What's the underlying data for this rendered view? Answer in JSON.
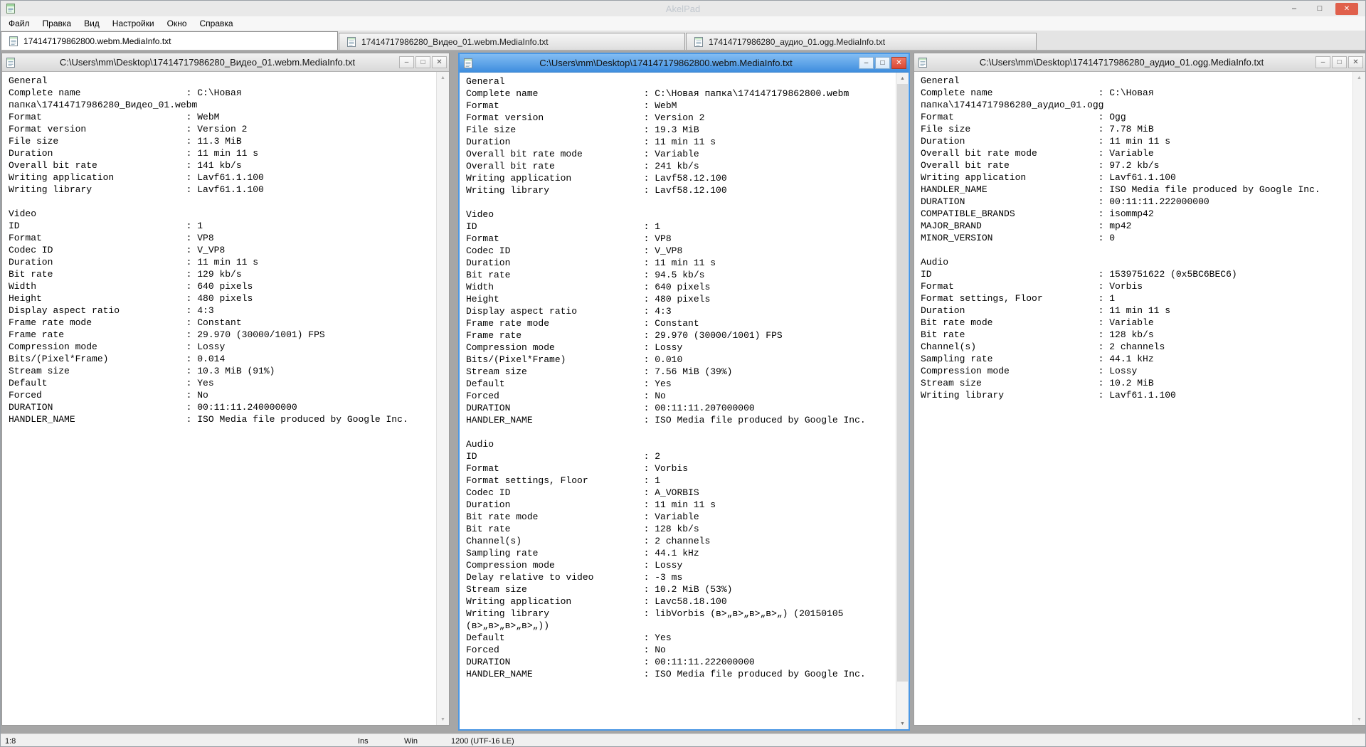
{
  "app": {
    "title": "AkelPad"
  },
  "glyphs": {
    "minimize": "–",
    "maximize": "□",
    "close": "✕",
    "scroll_up": "▲",
    "scroll_down": "▼"
  },
  "colors": {
    "active_titlebar": "#4a97e4",
    "main_close_button": "#e0604c",
    "child_close_button": "#db4734"
  },
  "menu": {
    "items": [
      "Файл",
      "Правка",
      "Вид",
      "Настройки",
      "Окно",
      "Справка"
    ]
  },
  "tabs": [
    {
      "label": "174147179862800.webm.MediaInfo.txt",
      "active": true,
      "icon": "document-icon"
    },
    {
      "label": "17414717986280_Видео_01.webm.MediaInfo.txt",
      "active": false,
      "icon": "document-icon"
    },
    {
      "label": "17414717986280_аудио_01.ogg.MediaInfo.txt",
      "active": false,
      "icon": "document-icon"
    }
  ],
  "windows": [
    {
      "title": "C:\\Users\\mm\\Desktop\\17414717986280_Видео_01.webm.MediaInfo.txt",
      "active": false,
      "lines": [
        [
          "General"
        ],
        [
          "Complete name",
          "C:\\Новая"
        ],
        [
          "папка\\17414717986280_Видео_01.webm"
        ],
        [
          "Format",
          "WebM"
        ],
        [
          "Format version",
          "Version 2"
        ],
        [
          "File size",
          "11.3 MiB"
        ],
        [
          "Duration",
          "11 min 11 s"
        ],
        [
          "Overall bit rate",
          "141 kb/s"
        ],
        [
          "Writing application",
          "Lavf61.1.100"
        ],
        [
          "Writing library",
          "Lavf61.1.100"
        ],
        [],
        [
          "Video"
        ],
        [
          "ID",
          "1"
        ],
        [
          "Format",
          "VP8"
        ],
        [
          "Codec ID",
          "V_VP8"
        ],
        [
          "Duration",
          "11 min 11 s"
        ],
        [
          "Bit rate",
          "129 kb/s"
        ],
        [
          "Width",
          "640 pixels"
        ],
        [
          "Height",
          "480 pixels"
        ],
        [
          "Display aspect ratio",
          "4:3"
        ],
        [
          "Frame rate mode",
          "Constant"
        ],
        [
          "Frame rate",
          "29.970 (30000/1001) FPS"
        ],
        [
          "Compression mode",
          "Lossy"
        ],
        [
          "Bits/(Pixel*Frame)",
          "0.014"
        ],
        [
          "Stream size",
          "10.3 MiB (91%)"
        ],
        [
          "Default",
          "Yes"
        ],
        [
          "Forced",
          "No"
        ],
        [
          "DURATION",
          "00:11:11.240000000"
        ],
        [
          "HANDLER_NAME",
          "ISO Media file produced by Google Inc."
        ]
      ]
    },
    {
      "title": "C:\\Users\\mm\\Desktop\\174147179862800.webm.MediaInfo.txt",
      "active": true,
      "lines": [
        [
          "General"
        ],
        [
          "Complete name",
          "C:\\Новая папка\\174147179862800.webm"
        ],
        [
          "Format",
          "WebM"
        ],
        [
          "Format version",
          "Version 2"
        ],
        [
          "File size",
          "19.3 MiB"
        ],
        [
          "Duration",
          "11 min 11 s"
        ],
        [
          "Overall bit rate mode",
          "Variable"
        ],
        [
          "Overall bit rate",
          "241 kb/s"
        ],
        [
          "Writing application",
          "Lavf58.12.100"
        ],
        [
          "Writing library",
          "Lavf58.12.100"
        ],
        [],
        [
          "Video"
        ],
        [
          "ID",
          "1"
        ],
        [
          "Format",
          "VP8"
        ],
        [
          "Codec ID",
          "V_VP8"
        ],
        [
          "Duration",
          "11 min 11 s"
        ],
        [
          "Bit rate",
          "94.5 kb/s"
        ],
        [
          "Width",
          "640 pixels"
        ],
        [
          "Height",
          "480 pixels"
        ],
        [
          "Display aspect ratio",
          "4:3"
        ],
        [
          "Frame rate mode",
          "Constant"
        ],
        [
          "Frame rate",
          "29.970 (30000/1001) FPS"
        ],
        [
          "Compression mode",
          "Lossy"
        ],
        [
          "Bits/(Pixel*Frame)",
          "0.010"
        ],
        [
          "Stream size",
          "7.56 MiB (39%)"
        ],
        [
          "Default",
          "Yes"
        ],
        [
          "Forced",
          "No"
        ],
        [
          "DURATION",
          "00:11:11.207000000"
        ],
        [
          "HANDLER_NAME",
          "ISO Media file produced by Google Inc."
        ],
        [],
        [
          "Audio"
        ],
        [
          "ID",
          "2"
        ],
        [
          "Format",
          "Vorbis"
        ],
        [
          "Format settings, Floor",
          "1"
        ],
        [
          "Codec ID",
          "A_VORBIS"
        ],
        [
          "Duration",
          "11 min 11 s"
        ],
        [
          "Bit rate mode",
          "Variable"
        ],
        [
          "Bit rate",
          "128 kb/s"
        ],
        [
          "Channel(s)",
          "2 channels"
        ],
        [
          "Sampling rate",
          "44.1 kHz"
        ],
        [
          "Compression mode",
          "Lossy"
        ],
        [
          "Delay relative to video",
          "-3 ms"
        ],
        [
          "Stream size",
          "10.2 MiB (53%)"
        ],
        [
          "Writing application",
          "Lavc58.18.100"
        ],
        [
          "Writing library",
          "libVorbis (в>„в>„в>„в>„) (20150105"
        ],
        [
          "(в>„в>„в>„в>„))"
        ],
        [
          "Default",
          "Yes"
        ],
        [
          "Forced",
          "No"
        ],
        [
          "DURATION",
          "00:11:11.222000000"
        ],
        [
          "HANDLER_NAME",
          "ISO Media file produced by Google Inc."
        ]
      ]
    },
    {
      "title": "C:\\Users\\mm\\Desktop\\17414717986280_аудио_01.ogg.MediaInfo.txt",
      "active": false,
      "lines": [
        [
          "General"
        ],
        [
          "Complete name",
          "C:\\Новая"
        ],
        [
          "папка\\17414717986280_аудио_01.ogg"
        ],
        [
          "Format",
          "Ogg"
        ],
        [
          "File size",
          "7.78 MiB"
        ],
        [
          "Duration",
          "11 min 11 s"
        ],
        [
          "Overall bit rate mode",
          "Variable"
        ],
        [
          "Overall bit rate",
          "97.2 kb/s"
        ],
        [
          "Writing application",
          "Lavf61.1.100"
        ],
        [
          "HANDLER_NAME",
          "ISO Media file produced by Google Inc."
        ],
        [
          "DURATION",
          "00:11:11.222000000"
        ],
        [
          "COMPATIBLE_BRANDS",
          "isommp42"
        ],
        [
          "MAJOR_BRAND",
          "mp42"
        ],
        [
          "MINOR_VERSION",
          "0"
        ],
        [],
        [
          "Audio"
        ],
        [
          "ID",
          "1539751622 (0x5BC6BEC6)"
        ],
        [
          "Format",
          "Vorbis"
        ],
        [
          "Format settings, Floor",
          "1"
        ],
        [
          "Duration",
          "11 min 11 s"
        ],
        [
          "Bit rate mode",
          "Variable"
        ],
        [
          "Bit rate",
          "128 kb/s"
        ],
        [
          "Channel(s)",
          "2 channels"
        ],
        [
          "Sampling rate",
          "44.1 kHz"
        ],
        [
          "Compression mode",
          "Lossy"
        ],
        [
          "Stream size",
          "10.2 MiB"
        ],
        [
          "Writing library",
          "Lavf61.1.100"
        ]
      ]
    }
  ],
  "statusbar": {
    "caret": "1:8",
    "insert_mode": "Ins",
    "newline_format": "Win",
    "encoding": "1200 (UTF-16 LE)"
  }
}
